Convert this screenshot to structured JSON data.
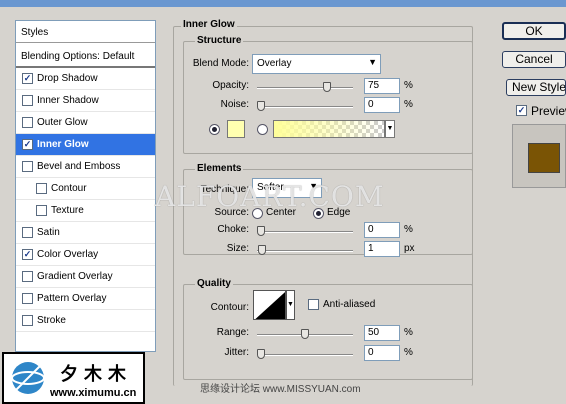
{
  "left_panel": {
    "header": "Styles",
    "blending_options": "Blending Options: Default",
    "items": [
      {
        "label": "Drop Shadow",
        "checked": true,
        "indent": false
      },
      {
        "label": "Inner Shadow",
        "checked": false,
        "indent": false
      },
      {
        "label": "Outer Glow",
        "checked": false,
        "indent": false
      },
      {
        "label": "Inner Glow",
        "checked": true,
        "indent": false,
        "selected": true
      },
      {
        "label": "Bevel and Emboss",
        "checked": false,
        "indent": false
      },
      {
        "label": "Contour",
        "checked": false,
        "indent": true
      },
      {
        "label": "Texture",
        "checked": false,
        "indent": true
      },
      {
        "label": "Satin",
        "checked": false,
        "indent": false
      },
      {
        "label": "Color Overlay",
        "checked": true,
        "indent": false
      },
      {
        "label": "Gradient Overlay",
        "checked": false,
        "indent": false
      },
      {
        "label": "Pattern Overlay",
        "checked": false,
        "indent": false
      },
      {
        "label": "Stroke",
        "checked": false,
        "indent": false
      }
    ]
  },
  "inner_glow": {
    "title": "Inner Glow",
    "structure": {
      "title": "Structure",
      "blend_mode_label": "Blend Mode:",
      "blend_mode_value": "Overlay",
      "opacity_label": "Opacity:",
      "opacity_value": "75",
      "opacity_pct": 75,
      "noise_label": "Noise:",
      "noise_value": "0",
      "noise_pct": 0,
      "unit_pct": "%",
      "color_swatch": "#ffffb0",
      "gradient_start": "#ffff99"
    },
    "elements": {
      "title": "Elements",
      "technique_label": "Technique:",
      "technique_value": "Softer",
      "source_label": "Source:",
      "source_center": "Center",
      "source_edge": "Edge",
      "source_selected": "Edge",
      "choke_label": "Choke:",
      "choke_value": "0",
      "choke_pct": 0,
      "size_label": "Size:",
      "size_value": "1",
      "size_unit": "px",
      "size_pct": 1
    },
    "quality": {
      "title": "Quality",
      "contour_label": "Contour:",
      "anti_aliased_label": "Anti-aliased",
      "anti_aliased": false,
      "range_label": "Range:",
      "range_value": "50",
      "range_pct": 50,
      "jitter_label": "Jitter:",
      "jitter_value": "0",
      "jitter_pct": 0
    }
  },
  "right_buttons": {
    "ok": "OK",
    "cancel": "Cancel",
    "new_style": "New Style",
    "preview_label": "Preview",
    "preview_checked": true,
    "preview_color": "#7a5405"
  },
  "watermark": "ALFOART.COM",
  "logo": {
    "name": "夕木木",
    "url": "www.ximumu.cn"
  },
  "footer": "思缘设计论坛  www.MISSYUAN.com"
}
